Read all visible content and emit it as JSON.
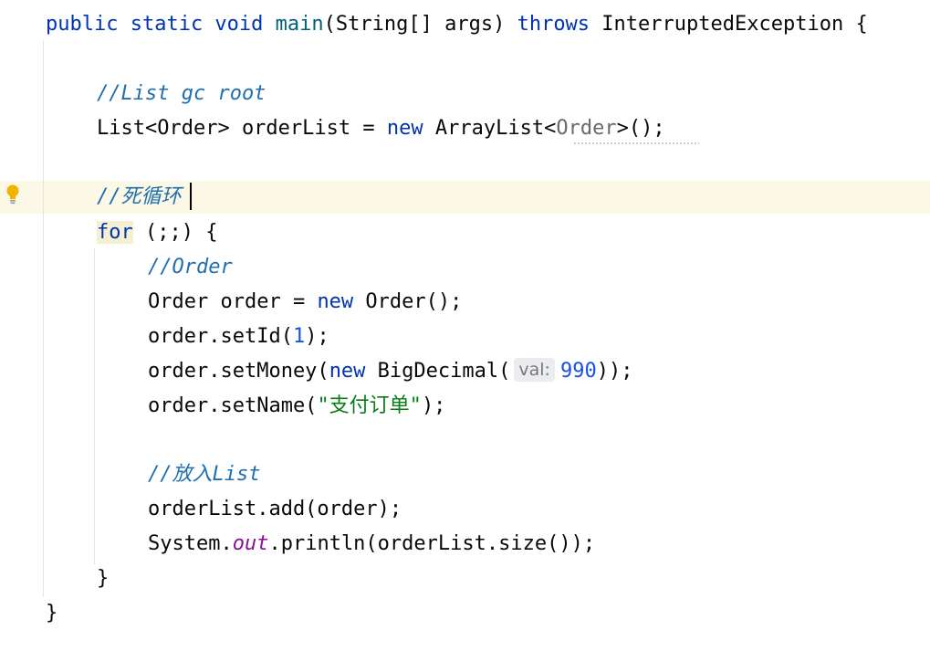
{
  "editor": {
    "lines": {
      "main_kw": "public static void ",
      "main_name": "main",
      "main_params": "(String[] args) ",
      "main_throws": "throws",
      "main_rest": " InterruptedException {",
      "comment_list_root": "//List gc root",
      "list_decl_pre": "List<Order> orderList = ",
      "list_decl_new": "new",
      "list_decl_type": " ArrayList<",
      "list_decl_generic": "Order",
      "list_decl_post": ">();",
      "comment_loop": "//死循环",
      "for_kw": "for",
      "for_rest": " (;;) {",
      "comment_order": "//Order",
      "order_decl_pre": "Order order = ",
      "order_decl_new": "new",
      "order_decl_post": " Order();",
      "setid_pre": "order.setId(",
      "setid_num": "1",
      "setid_post": ");",
      "setmoney_pre": "order.setMoney(",
      "setmoney_new": "new",
      "setmoney_type": " BigDecimal(",
      "setmoney_hint": "val:",
      "setmoney_num": "990",
      "setmoney_post": "));",
      "setname_pre": "order.setName(",
      "setname_str": "\"支付订单\"",
      "setname_post": ");",
      "comment_add": "//放入List",
      "add_call": "orderList.add(order);",
      "println_pre": "System.",
      "println_field": "out",
      "println_post": ".println(orderList.size());",
      "close_for": "}",
      "close_main": "}"
    },
    "gutter_icon": "lightbulb-icon"
  }
}
